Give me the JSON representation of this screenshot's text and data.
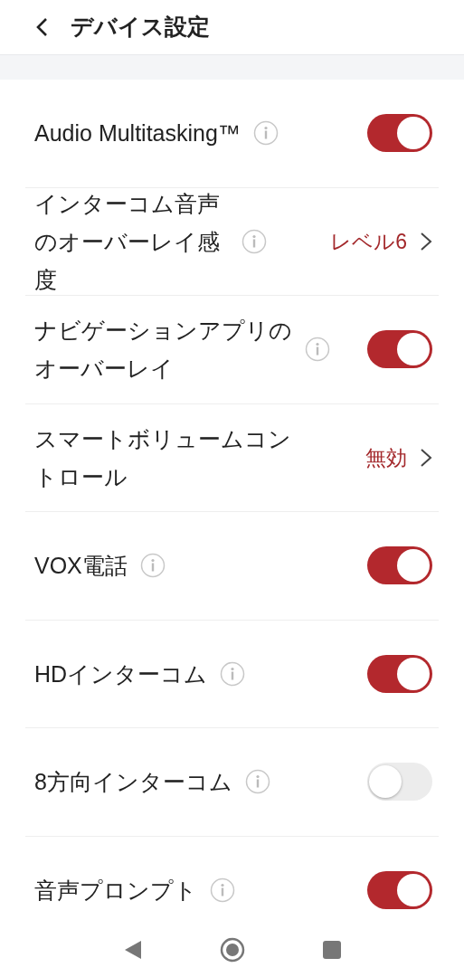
{
  "header": {
    "title": "デバイス設定"
  },
  "settings": [
    {
      "kind": "toggle",
      "label": "Audio Multitasking™",
      "info": true,
      "on": true
    },
    {
      "kind": "select",
      "label": "インターコム音声のオーバーレイ感度",
      "info": true,
      "value": "レベル6"
    },
    {
      "kind": "toggle",
      "label": "ナビゲーションアプリのオーバーレイ",
      "info": true,
      "on": true
    },
    {
      "kind": "select",
      "label": "スマートボリュームコントロール",
      "info": false,
      "value": "無効"
    },
    {
      "kind": "toggle",
      "label": "VOX電話",
      "info": true,
      "on": true
    },
    {
      "kind": "toggle",
      "label": "HDインターコム",
      "info": true,
      "on": true
    },
    {
      "kind": "toggle",
      "label": "8方向インターコム",
      "info": true,
      "on": false
    },
    {
      "kind": "toggle",
      "label": "音声プロンプト",
      "info": true,
      "on": true
    }
  ]
}
